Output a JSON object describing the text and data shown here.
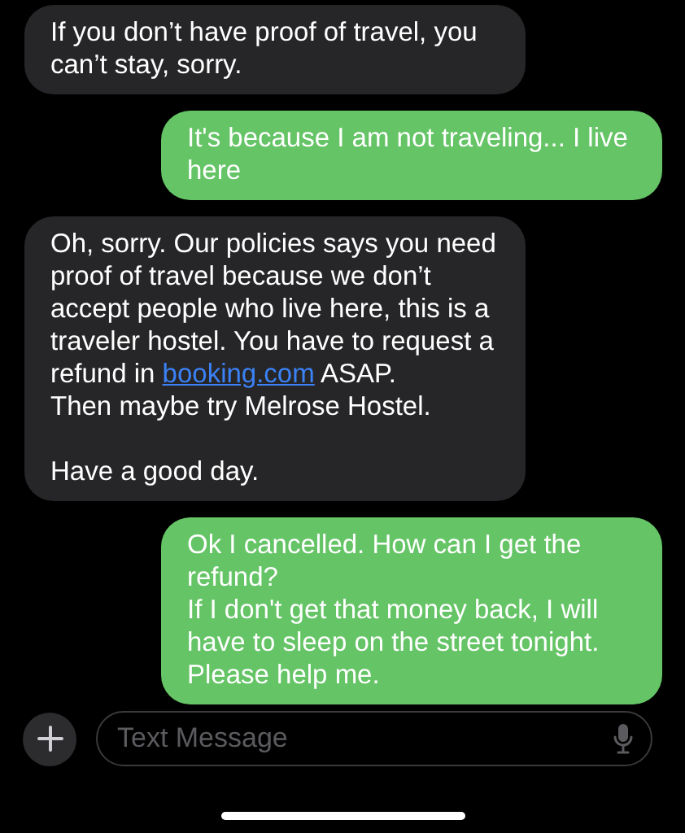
{
  "messages": [
    {
      "kind": "received",
      "parts": [
        {
          "kind": "text",
          "text": "If you don’t have proof of travel, you can’t stay, sorry."
        }
      ]
    },
    {
      "kind": "sent",
      "parts": [
        {
          "kind": "text",
          "text": "It's because I am not traveling... I live here"
        }
      ]
    },
    {
      "kind": "received",
      "parts": [
        {
          "kind": "text",
          "text": "Oh, sorry. Our policies says you need proof of travel because we don’t accept people who live here, this is a traveler hostel. You have to request a refund in "
        },
        {
          "kind": "link",
          "text": "booking.com"
        },
        {
          "kind": "text",
          "text": " ASAP.\nThen maybe try Melrose Hostel.\n\nHave a good day."
        }
      ]
    },
    {
      "kind": "sent",
      "parts": [
        {
          "kind": "text",
          "text": "Ok I cancelled. How can I get the refund?\nIf I don't get that money back, I will have to sleep on the street tonight.\nPlease help me."
        }
      ]
    }
  ],
  "composer": {
    "placeholder": "Text Message"
  }
}
